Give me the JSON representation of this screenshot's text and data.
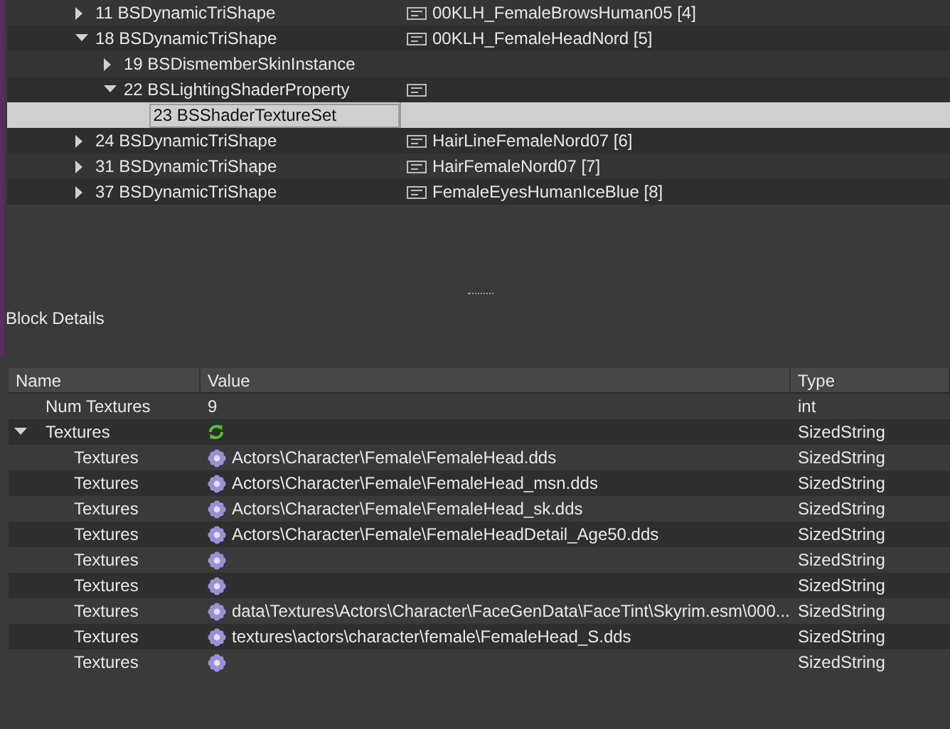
{
  "tree": {
    "rows": [
      {
        "label": "11 BSDynamicTriShape",
        "has_children": true,
        "expanded": false,
        "selected": false,
        "string_icon": true,
        "value": "00KLH_FemaleBrowsHuman05 [4]"
      },
      {
        "label": "18 BSDynamicTriShape",
        "has_children": true,
        "expanded": true,
        "selected": false,
        "string_icon": true,
        "value": "00KLH_FemaleHeadNord [5]",
        "children": [
          {
            "label": "19 BSDismemberSkinInstance",
            "has_children": true,
            "expanded": false,
            "selected": false,
            "string_icon": false
          },
          {
            "label": "22 BSLightingShaderProperty",
            "has_children": true,
            "expanded": true,
            "selected": false,
            "string_icon": true,
            "children": [
              {
                "label": "23 BSShaderTextureSet",
                "has_children": false,
                "expanded": false,
                "selected": true,
                "string_icon": false
              }
            ]
          }
        ]
      },
      {
        "label": "24 BSDynamicTriShape",
        "has_children": true,
        "expanded": false,
        "selected": false,
        "string_icon": true,
        "value": "HairLineFemaleNord07 [6]"
      },
      {
        "label": "31 BSDynamicTriShape",
        "has_children": true,
        "expanded": false,
        "selected": false,
        "string_icon": true,
        "value": "HairFemaleNord07 [7]"
      },
      {
        "label": "37 BSDynamicTriShape",
        "has_children": true,
        "expanded": false,
        "selected": false,
        "string_icon": true,
        "value": "FemaleEyesHumanIceBlue [8]"
      }
    ]
  },
  "block_details": {
    "title": "Block Details",
    "columns": [
      "Name",
      "Value",
      "Type"
    ],
    "rows": [
      {
        "name": "Num Textures",
        "kind": "plain",
        "value": "9",
        "type": "int"
      },
      {
        "name": "Textures",
        "kind": "array",
        "expanded": true,
        "type": "SizedString",
        "children": [
          {
            "name": "Textures",
            "kind": "string",
            "value": "Actors\\Character\\Female\\FemaleHead.dds",
            "type": "SizedString"
          },
          {
            "name": "Textures",
            "kind": "string",
            "value": "Actors\\Character\\Female\\FemaleHead_msn.dds",
            "type": "SizedString"
          },
          {
            "name": "Textures",
            "kind": "string",
            "value": "Actors\\Character\\Female\\FemaleHead_sk.dds",
            "type": "SizedString"
          },
          {
            "name": "Textures",
            "kind": "string",
            "value": "Actors\\Character\\Female\\FemaleHeadDetail_Age50.dds",
            "type": "SizedString"
          },
          {
            "name": "Textures",
            "kind": "string",
            "type": "SizedString"
          },
          {
            "name": "Textures",
            "kind": "string",
            "type": "SizedString"
          },
          {
            "name": "Textures",
            "kind": "string",
            "value": "data\\Textures\\Actors\\Character\\FaceGenData\\FaceTint\\Skyrim.esm\\000...",
            "type": "SizedString"
          },
          {
            "name": "Textures",
            "kind": "string",
            "value": "textures\\actors\\character\\female\\FemaleHead_S.dds",
            "type": "SizedString"
          },
          {
            "name": "Textures",
            "kind": "string",
            "type": "SizedString"
          }
        ]
      }
    ]
  }
}
